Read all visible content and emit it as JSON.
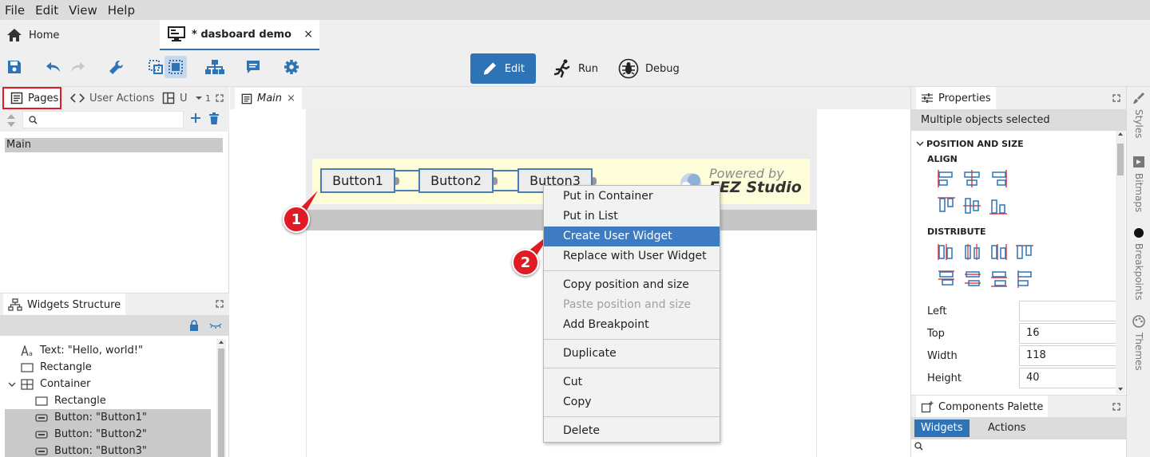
{
  "menubar": {
    "items": [
      "File",
      "Edit",
      "View",
      "Help"
    ]
  },
  "tabs": {
    "home": "Home",
    "demo": "* dasboard demo",
    "close": "×"
  },
  "toolbar": {
    "edit": "Edit",
    "run": "Run",
    "debug": "Debug"
  },
  "left_panel": {
    "tabs": {
      "pages": "Pages",
      "user_actions": "User Actions",
      "u": "U",
      "more": "1"
    },
    "pages": [
      "Main"
    ],
    "widgets_structure": {
      "title": "Widgets Structure",
      "items": [
        {
          "label": "Text: \"Hello, world!\"",
          "icon": "text-icon"
        },
        {
          "label": "Rectangle",
          "icon": "rectangle-icon"
        },
        {
          "label": "Container",
          "icon": "container-icon"
        },
        {
          "label": "Rectangle",
          "icon": "rectangle-icon"
        },
        {
          "label": "Button: \"Button1\"",
          "icon": "button-icon"
        },
        {
          "label": "Button: \"Button2\"",
          "icon": "button-icon"
        },
        {
          "label": "Button: \"Button3\"",
          "icon": "button-icon"
        }
      ]
    }
  },
  "center": {
    "tab": "Main",
    "buttons": [
      "Button1",
      "Button2",
      "Button3"
    ],
    "logo": {
      "powered": "Powered by",
      "studio": "EEZ Studio"
    }
  },
  "callouts": [
    "1",
    "2"
  ],
  "context_menu": {
    "items": [
      "Put in Container",
      "Put in List",
      "Create User Widget",
      "Replace with User Widget",
      "Copy position and size",
      "Paste position and size",
      "Add Breakpoint",
      "Duplicate",
      "Cut",
      "Copy",
      "Delete"
    ],
    "highlighted": "Create User Widget",
    "disabled": "Paste position and size"
  },
  "right_panel": {
    "title": "Properties",
    "selection": "Multiple objects selected",
    "section": "POSITION AND SIZE",
    "align": "ALIGN",
    "distribute": "DISTRIBUTE",
    "props": [
      {
        "label": "Left",
        "value": ""
      },
      {
        "label": "Top",
        "value": "16"
      },
      {
        "label": "Width",
        "value": "118"
      },
      {
        "label": "Height",
        "value": "40"
      }
    ],
    "palette": {
      "title": "Components Palette",
      "widgets": "Widgets",
      "actions": "Actions"
    }
  },
  "side_tabs": [
    "Styles",
    "Bitmaps",
    "Breakpoints",
    "Themes"
  ],
  "colors": {
    "accent": "#2d73b5",
    "highlight": "#e01b24",
    "menu_highlight": "#3e7bc1"
  }
}
